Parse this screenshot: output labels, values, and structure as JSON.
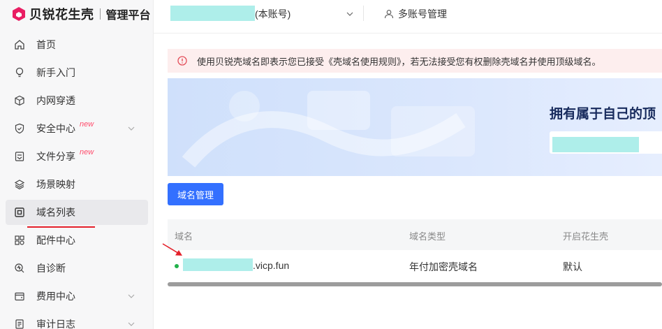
{
  "brand": {
    "name": "贝锐花生壳",
    "subtitle": "管理平台",
    "color": "#e91e63"
  },
  "header": {
    "account_suffix": "(本账号)",
    "multi_account": "多账号管理"
  },
  "sidebar": {
    "items": [
      {
        "label": "首页",
        "icon": "home-icon"
      },
      {
        "label": "新手入门",
        "icon": "lightbulb-icon"
      },
      {
        "label": "内网穿透",
        "icon": "cube-icon"
      },
      {
        "label": "安全中心",
        "icon": "shield-icon",
        "badge": "new"
      },
      {
        "label": "文件分享",
        "icon": "file-share-icon",
        "badge": "new"
      },
      {
        "label": "场景映射",
        "icon": "scene-icon"
      },
      {
        "label": "域名列表",
        "icon": "domain-icon"
      },
      {
        "label": "配件中心",
        "icon": "grid-icon"
      },
      {
        "label": "自诊断",
        "icon": "diagnose-icon"
      },
      {
        "label": "费用中心",
        "icon": "wallet-icon"
      },
      {
        "label": "审计日志",
        "icon": "log-icon"
      }
    ]
  },
  "alert": {
    "text": "使用贝锐壳域名即表示您已接受《壳域名使用规则》，若无法接受您有权删除壳域名并使用顶级域名。"
  },
  "banner": {
    "title": "拥有属于自己的顶"
  },
  "buttons": {
    "domain_manage": "域名管理"
  },
  "table": {
    "headers": [
      "域名",
      "域名类型",
      "开启花生壳"
    ],
    "rows": [
      {
        "domain_suffix": ".vicp.fun",
        "type": "年付加密壳域名",
        "enabled": "默认"
      }
    ]
  },
  "colors": {
    "primary": "#3370ff",
    "alert_bg": "#fdeeee",
    "alert_icon": "#e34d59",
    "active_underline": "#e4202a",
    "status_dot": "#21b14a"
  }
}
